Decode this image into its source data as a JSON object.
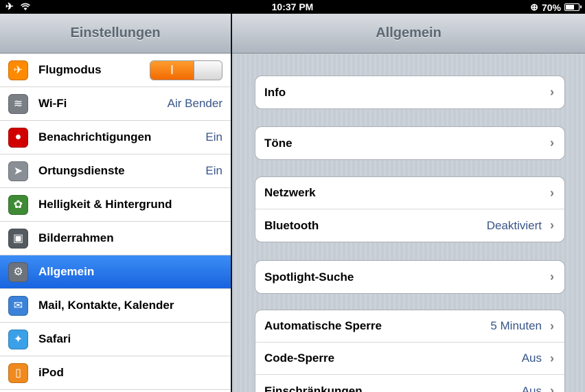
{
  "status": {
    "time": "10:37 PM",
    "battery": "70%",
    "battery_level": 0.7
  },
  "left": {
    "title": "Einstellungen",
    "rows": [
      {
        "label": "Flugmodus",
        "value": "",
        "icon": "airplane-icon",
        "icon_color": "#ff8a00",
        "toggle_label": "I"
      },
      {
        "label": "Wi-Fi",
        "value": "Air Bender",
        "icon": "wifi-icon",
        "icon_color": "#7a7f86"
      },
      {
        "label": "Benachrichtigungen",
        "value": "Ein",
        "icon": "notifications-icon",
        "icon_color": "#d10000"
      },
      {
        "label": "Ortungsdienste",
        "value": "Ein",
        "icon": "location-icon",
        "icon_color": "#8a8f96"
      },
      {
        "label": "Helligkeit & Hintergrund",
        "value": "",
        "icon": "flower-icon",
        "icon_color": "#3f8a35"
      },
      {
        "label": "Bilderrahmen",
        "value": "",
        "icon": "picture-frame-icon",
        "icon_color": "#555a60"
      },
      {
        "label": "Allgemein",
        "value": "",
        "icon": "gear-icon",
        "icon_color": "#6c737c",
        "selected": true
      },
      {
        "label": "Mail, Kontakte, Kalender",
        "value": "",
        "icon": "mail-icon",
        "icon_color": "#3b82d8"
      },
      {
        "label": "Safari",
        "value": "",
        "icon": "compass-icon",
        "icon_color": "#3aa0e8"
      },
      {
        "label": "iPod",
        "value": "",
        "icon": "ipod-icon",
        "icon_color": "#f08a1e"
      }
    ]
  },
  "right": {
    "title": "Allgemein",
    "groups": [
      [
        {
          "label": "Info",
          "value": ""
        }
      ],
      [
        {
          "label": "Töne",
          "value": ""
        }
      ],
      [
        {
          "label": "Netzwerk",
          "value": ""
        },
        {
          "label": "Bluetooth",
          "value": "Deaktiviert"
        }
      ],
      [
        {
          "label": "Spotlight-Suche",
          "value": ""
        }
      ],
      [
        {
          "label": "Automatische Sperre",
          "value": "5 Minuten"
        },
        {
          "label": "Code-Sperre",
          "value": "Aus"
        },
        {
          "label": "Einschränkungen",
          "value": "Aus"
        }
      ]
    ]
  }
}
